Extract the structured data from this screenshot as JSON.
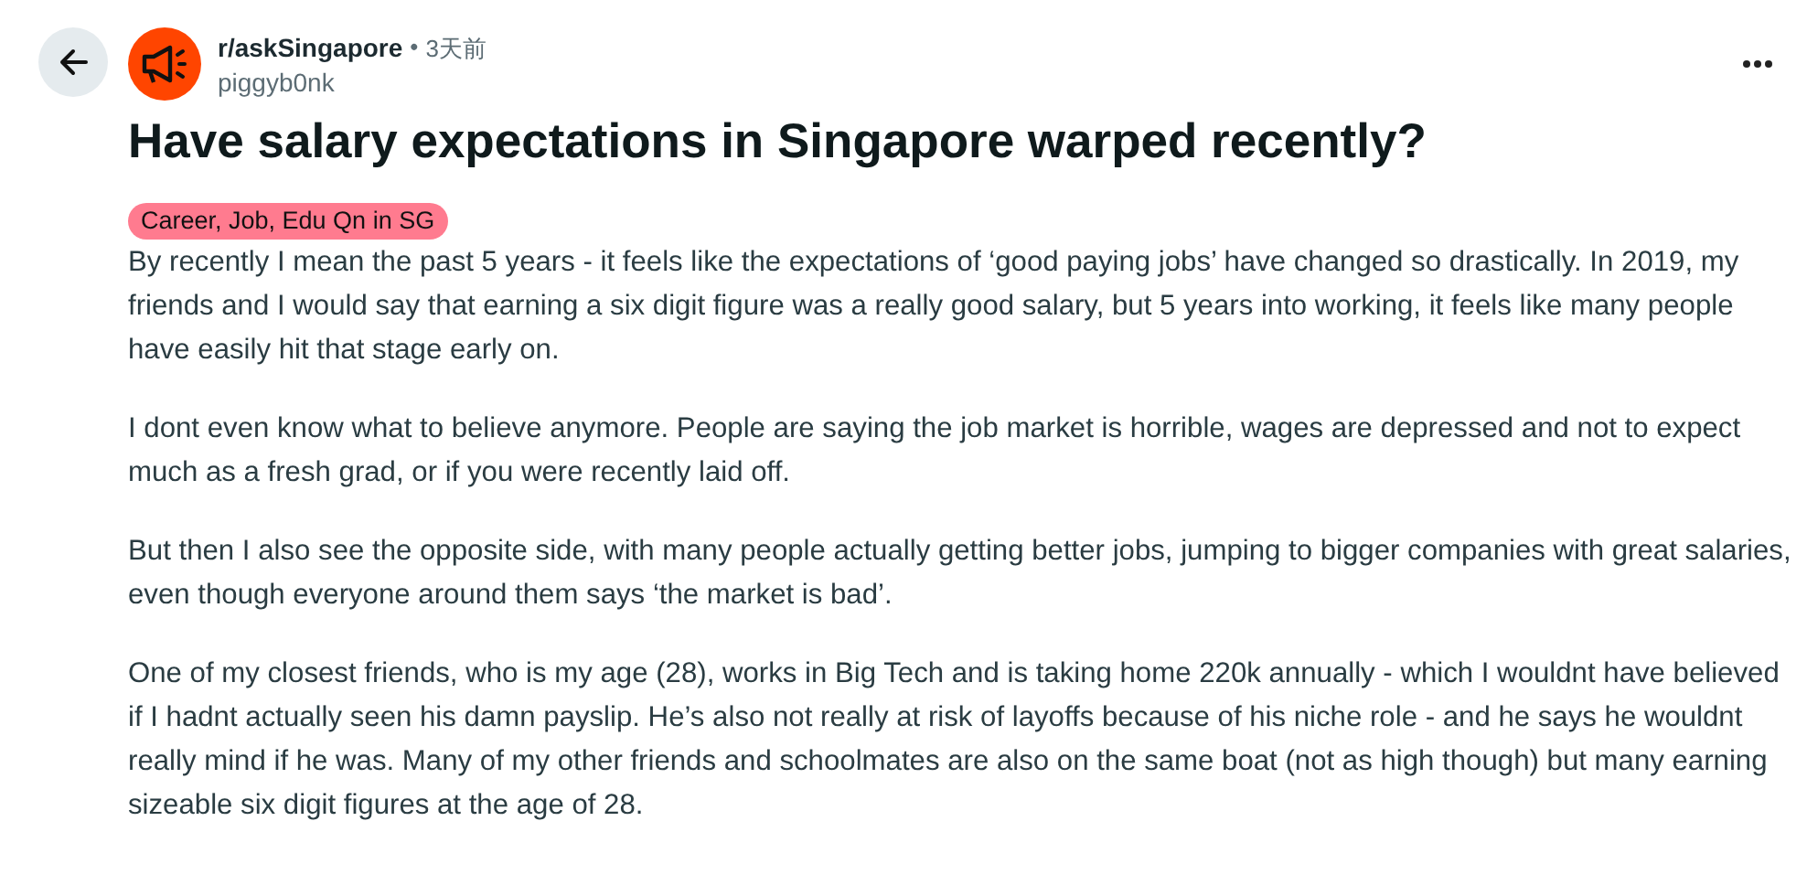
{
  "post": {
    "subreddit": "r/askSingapore",
    "separator": "•",
    "time": "3天前",
    "author": "piggyb0nk",
    "title": "Have salary expectations in Singapore warped recently?",
    "flair": {
      "label": "Career, Job, Edu Qn in SG",
      "color": "#ff7b8f"
    },
    "paragraphs": [
      "By recently I mean the past 5 years - it feels like the expectations of ‘good paying jobs’ have changed so drastically. In 2019, my friends and I would say that earning a six digit figure was a really good salary, but 5 years into working, it feels like many people have easily hit that stage early on.",
      "I dont even know what to believe anymore. People are saying the job market is horrible, wages are depressed and not to expect much as a fresh grad, or if you were recently laid off.",
      "But then I also see the opposite side, with many people actually getting better jobs, jumping to bigger companies with great salaries, even though everyone around them says ‘the market is bad’.",
      "One of my closest friends, who is my age (28), works in Big Tech and is taking home 220k annually - which I wouldnt have believed if I hadnt actually seen his damn payslip. He’s also not really at risk of layoffs because of his niche role - and he says he wouldnt really mind if he was. Many of my other friends and schoolmates are also on the same boat (not as high though) but many earning sizeable six digit figures at the age of 28."
    ]
  }
}
